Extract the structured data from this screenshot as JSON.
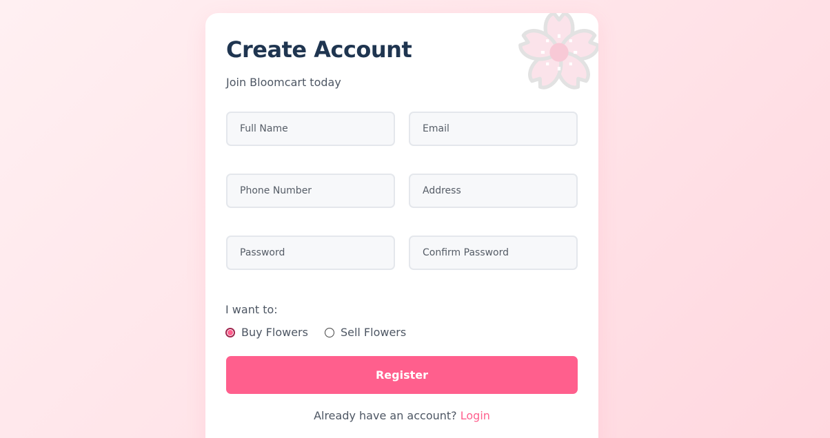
{
  "brand": {
    "accent": "#ff5f8d",
    "title_color": "#1f3550"
  },
  "header": {
    "title": "Create Account",
    "subtitle": "Join Bloomcart today"
  },
  "decoration": {
    "icon": "cherry-blossom-icon"
  },
  "form": {
    "full_name": {
      "placeholder": "Full Name",
      "value": ""
    },
    "email": {
      "placeholder": "Email",
      "value": ""
    },
    "phone": {
      "placeholder": "Phone Number",
      "value": ""
    },
    "address": {
      "placeholder": "Address",
      "value": ""
    },
    "password": {
      "placeholder": "Password",
      "value": ""
    },
    "confirm_password": {
      "placeholder": "Confirm Password",
      "value": ""
    }
  },
  "role": {
    "label": "I want to:",
    "options": [
      {
        "label": "Buy Flowers",
        "selected": true
      },
      {
        "label": "Sell Flowers",
        "selected": false
      }
    ]
  },
  "actions": {
    "register_label": "Register"
  },
  "footer": {
    "prompt": "Already have an account?",
    "login_label": "Login"
  }
}
